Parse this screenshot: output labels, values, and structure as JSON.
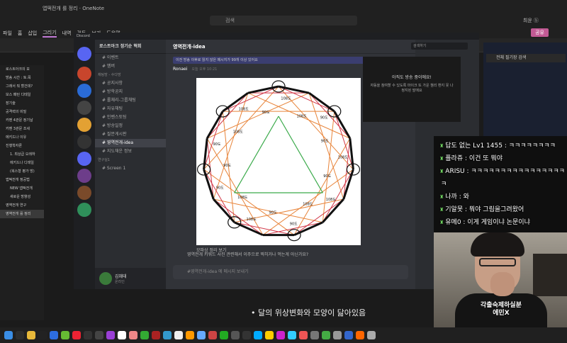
{
  "onenote": {
    "title": "앱떡전개 를 정리 · OneNote",
    "search_placeholder": "검색",
    "account": "최윤 ⓑ",
    "ms365": "Microsoft 365 구입",
    "tabs": [
      "파일",
      "홈",
      "삽입",
      "그리기",
      "내역",
      "검토",
      "보기",
      "도움말"
    ],
    "active_tab": "그리기",
    "share_label": "공유",
    "right_tab": "보기",
    "right_bar": "전체 필기장 검색",
    "pages": [
      {
        "label": "로스트아크의 모",
        "indent": false
      },
      {
        "label": "방송 시간 : 토.목",
        "indent": false
      },
      {
        "label": "그래서 뭐 할건데?",
        "indent": false
      },
      {
        "label": "보스 패턴 디테일",
        "indent": false
      },
      {
        "label": "장기술",
        "indent": false
      },
      {
        "label": "공격력의 비밀",
        "indent": false
      },
      {
        "label": "카멘 4관문 정기날",
        "indent": false
      },
      {
        "label": "카멘 3관문 조세",
        "indent": false
      },
      {
        "label": "에키드나 이유",
        "indent": false
      },
      {
        "label": "진행학자론",
        "indent": false
      },
      {
        "label": "1. 최상급 오레하",
        "indent": true
      },
      {
        "label": "에키드나 디테일",
        "indent": true
      },
      {
        "label": "(복스형 평가 방)",
        "indent": true
      },
      {
        "label": "앱떡전개 정공법",
        "indent": false
      },
      {
        "label": "NEW 앱떡전개",
        "indent": true
      },
      {
        "label": "새로운 방향성",
        "indent": true
      },
      {
        "label": "영역전개 연구",
        "indent": false
      },
      {
        "label": "영역전개 를 정리",
        "indent": false,
        "selected": true
      }
    ]
  },
  "discord": {
    "window_title": "Discord",
    "server_name": "로스트아크 정기순 혁회",
    "channels": [
      {
        "label": "이벤트",
        "type": "item"
      },
      {
        "label": "멤버",
        "type": "item"
      },
      {
        "label": "채팅방 - 수다방",
        "type": "category"
      },
      {
        "label": "공지사항",
        "type": "item"
      },
      {
        "label": "방학공지",
        "type": "item"
      },
      {
        "label": "롤체리-그룹채팅",
        "type": "item"
      },
      {
        "label": "자유채팅",
        "type": "item"
      },
      {
        "label": "인벤스토팅",
        "type": "item"
      },
      {
        "label": "방송일정",
        "type": "item"
      },
      {
        "label": "질문게시판",
        "type": "item"
      },
      {
        "label": "영역전개-idea",
        "type": "item",
        "selected": true
      },
      {
        "label": "지도채운 정보",
        "type": "item"
      },
      {
        "label": "연구실1",
        "type": "category"
      },
      {
        "label": "Screen 1",
        "type": "item"
      }
    ],
    "channel_header": "영역전개-idea",
    "notice": "이전 방송 이후로 읽지 않은 메시지가 99개 이상 있어요",
    "msg_author": "Ronaei",
    "msg_time": "오늘 오후 10:21",
    "bottom_msg": "영역전개 키워드 사진 관련해서 이주으로 찍히거나 먹는게 아닌가요?",
    "input_placeholder": "#영역전개-idea 에 메시지 보내기",
    "search_placeholder": "검색하기",
    "username": "김혜태",
    "user_status": "온라인",
    "popup_title": "아직도 방송 중이에요!",
    "popup_sub": "자동을 참여할 수 있도록 마이크 또 가운 챔리 환지 못 나 정지된 말에요",
    "figure_caption": "모파상 정리 보기"
  },
  "figure": {
    "labels": [
      "108도",
      "108도",
      "90도",
      "90도",
      "108도",
      "90도",
      "108도",
      "108도",
      "90도",
      "90도",
      "108도",
      "108도",
      "90도",
      "90도",
      "90도",
      "108도",
      "108도",
      "90도"
    ]
  },
  "chat": [
    {
      "text": "답도 없는 Lv1 1455 : ㅋㅋㅋㅋㅋㅋㅋㅋ"
    },
    {
      "text": "플라쥬 : 이건 또 뭐야"
    },
    {
      "text": "ARISU : ㅋㅋㅋㅋㅋㅋㅋㅋㅋㅋㅋㅋㅋㅋㅋㅋ"
    },
    {
      "text": "ㅋ"
    },
    {
      "text": "나까 : 와"
    },
    {
      "text": "기알못 : 뭐야 그림을그려왔어"
    },
    {
      "text": "유메0 : 이게 게임이냐 논문이냐"
    }
  ],
  "cam_caption": "각출숙제하실분\n에민X",
  "bullet_text": "달의 위상변화와 모양이 닮아있음"
}
